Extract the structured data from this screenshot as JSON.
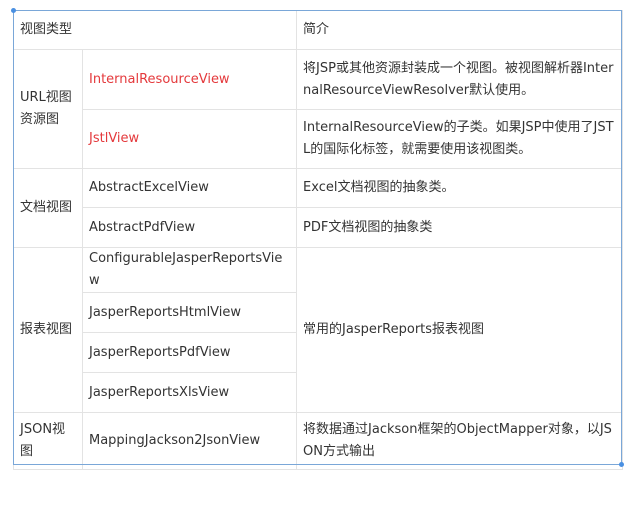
{
  "header": {
    "col1": "视图类型",
    "col2": "简介"
  },
  "groups": {
    "url": {
      "type": "URL视图资源图",
      "rows": [
        {
          "name": "InternalResourceView",
          "desc": "将JSP或其他资源封装成一个视图。被视图解析器InternalResourceViewResolver默认使用。"
        },
        {
          "name": "JstlView",
          "desc": "InternalResourceView的子类。如果JSP中使用了JSTL的国际化标签，就需要使用该视图类。"
        }
      ]
    },
    "doc": {
      "type": "文档视图",
      "rows": [
        {
          "name": "AbstractExcelView",
          "desc": "Excel文档视图的抽象类。"
        },
        {
          "name": "AbstractPdfView",
          "desc": "PDF文档视图的抽象类"
        }
      ]
    },
    "report": {
      "type": "报表视图",
      "desc": "常用的JasperReports报表视图",
      "rows": [
        {
          "name": "ConfigurableJasperReportsView"
        },
        {
          "name": "JasperReportsHtmlView"
        },
        {
          "name": "JasperReportsPdfView"
        },
        {
          "name": "JasperReportsXlsView"
        }
      ]
    },
    "json": {
      "type": "JSON视图",
      "rows": [
        {
          "name": "MappingJackson2JsonView",
          "desc": "将数据通过Jackson框架的ObjectMapper对象，以JSON方式输出"
        }
      ]
    }
  },
  "colors": {
    "highlight": "#e4393c",
    "border": "#e3e3e3",
    "selection": "#4a90e2"
  }
}
